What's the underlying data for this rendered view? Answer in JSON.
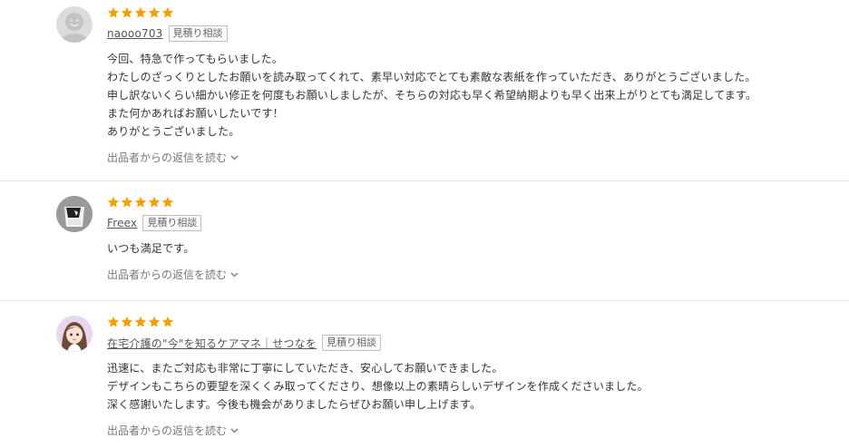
{
  "reviews": [
    {
      "rating": 5,
      "username": "naooo703",
      "badge": "見積り相談",
      "lines": [
        "今回、特急で作ってもらいました。",
        "わたしのざっくりとしたお願いを読み取ってくれて、素早い対応でとても素敵な表紙を作っていただき、ありがとうございました。",
        "申し訳ないくらい細かい修正を何度もお願いしましたが、そちらの対応も早く希望納期よりも早く出来上がりとても満足してます。",
        "また何かあればお願いしたいです！",
        "ありがとうございました。"
      ],
      "reply_label": "出品者からの返信を読む"
    },
    {
      "rating": 5,
      "username": "Freex",
      "badge": "見積り相談",
      "lines": [
        "いつも満足です。"
      ],
      "reply_label": "出品者からの返信を読む"
    },
    {
      "rating": 5,
      "username": "在宅介護の\"今\"を知るケアマネ｜せつなを",
      "badge": "見積り相談",
      "lines": [
        "迅速に、またご対応も非常に丁寧にしていただき、安心してお願いできました。",
        "デザインもこちらの要望を深くくみ取ってくださり、想像以上の素晴らしいデザインを作成くださいました。",
        "深く感謝いたします。今後も機会がありましたらぜひお願い申し上げます。"
      ],
      "reply_label": "出品者からの返信を読む"
    }
  ],
  "colors": {
    "star": "#f5a000",
    "divider": "#e6e6e6"
  }
}
